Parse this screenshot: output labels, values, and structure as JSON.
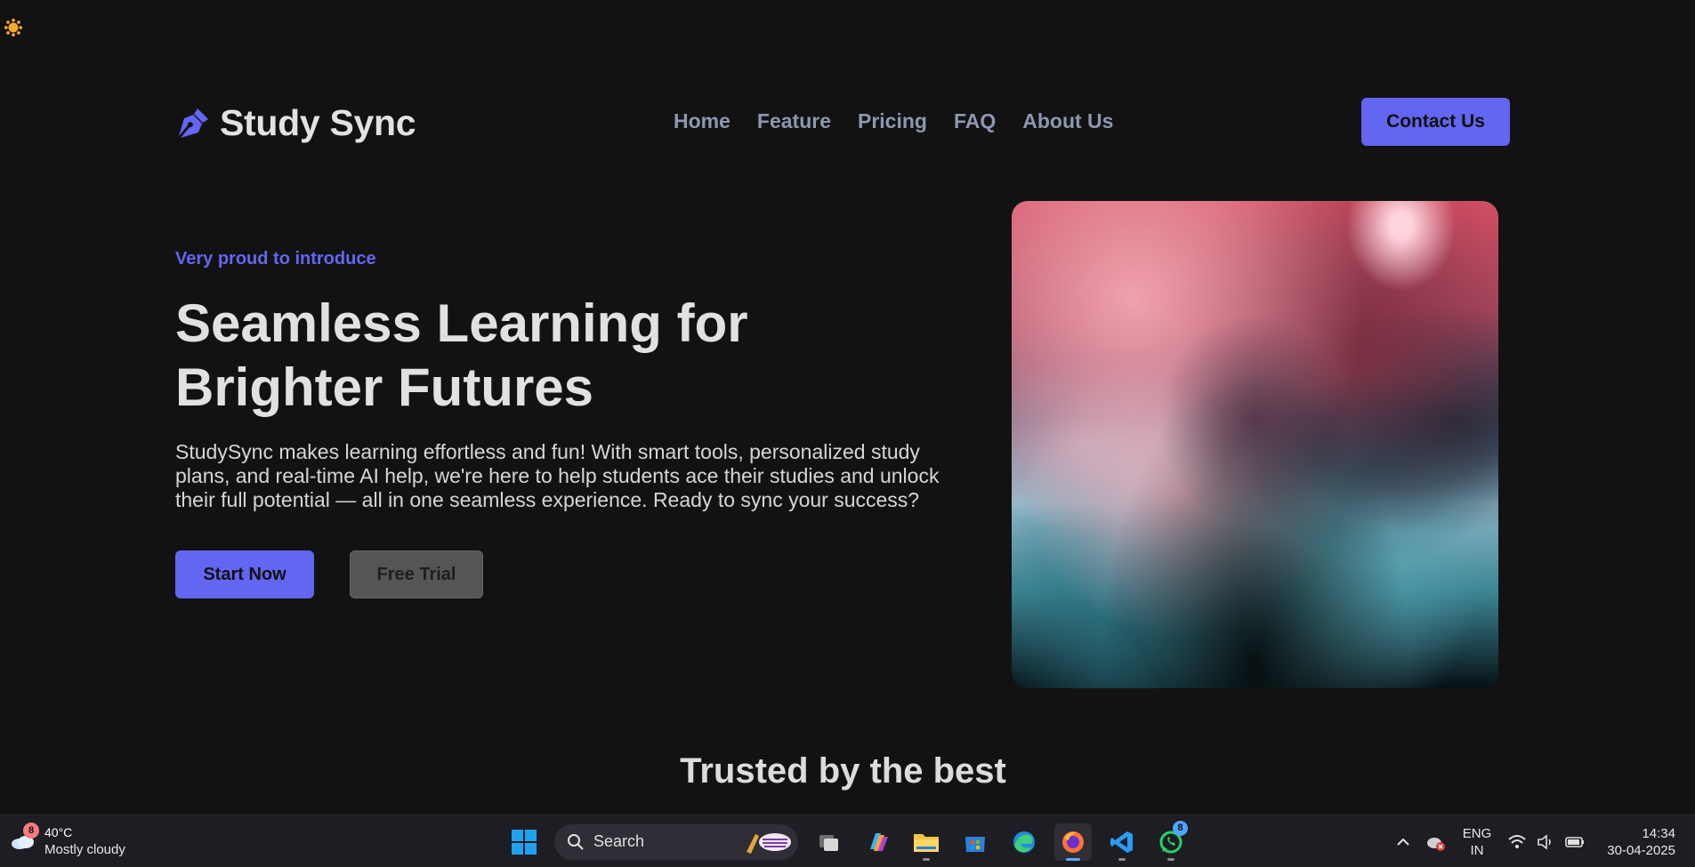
{
  "brand": {
    "name": "Study Sync"
  },
  "nav": {
    "links": [
      "Home",
      "Feature",
      "Pricing",
      "FAQ",
      "About Us"
    ],
    "contact_label": "Contact Us"
  },
  "hero": {
    "eyebrow": "Very proud to introduce",
    "headline": "Seamless Learning for Brighter Futures",
    "description": "StudySync makes learning effortless and fun! With smart tools, personalized study plans, and real-time AI help, we're here to help students ace their studies and unlock their full potential — all in one seamless experience. Ready to sync your success?",
    "primary_cta": "Start Now",
    "secondary_cta": "Free Trial"
  },
  "section": {
    "trusted_title": "Trusted by the best"
  },
  "colors": {
    "accent": "#6366f1",
    "background": "#121212"
  },
  "taskbar": {
    "weather": {
      "badge": "8",
      "temperature": "40°C",
      "condition": "Mostly cloudy"
    },
    "search_label": "Search",
    "whatsapp_badge": "8",
    "language": {
      "line1": "ENG",
      "line2": "IN"
    },
    "clock": {
      "time": "14:34",
      "date": "30-04-2025"
    }
  }
}
